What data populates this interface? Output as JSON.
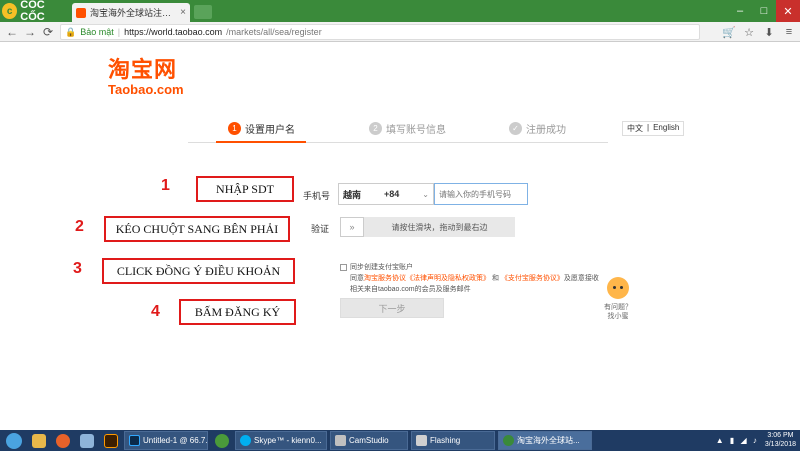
{
  "browser": {
    "brand": "CỐC CỐC",
    "tab_title": "淘宝海外全球站注册页面",
    "tab_close": "×",
    "secure_label": "Bảo mật",
    "url_host": "https://world.taobao.com",
    "url_path": "/markets/all/sea/register"
  },
  "page": {
    "logo_cn": "淘宝网",
    "logo_en": "Taobao.com",
    "steps": [
      {
        "num": "1",
        "label": "设置用户名"
      },
      {
        "num": "2",
        "label": "填写账号信息"
      },
      {
        "num": "✓",
        "label": "注册成功"
      }
    ],
    "lang": {
      "zh": "中文",
      "sep": "|",
      "en": "English"
    },
    "form": {
      "phone_label": "手机号",
      "country": "越南",
      "country_code": "+84",
      "phone_placeholder": "请输入你的手机号码",
      "verify_label": "验证",
      "slider_handle": "»",
      "slider_text": "请按住滑块，拖动到最右边",
      "agree_line1": "同步创建支付宝账户",
      "agree_prefix": "同意",
      "agree_link1": "淘宝服务协议",
      "agree_link2": "《法律声明及隐私权政策》",
      "agree_and": "和",
      "agree_link3": "《支付宝服务协议》",
      "agree_suffix": "及愿意接收",
      "agree_line3": "相关来自taobao.com的会员及服务邮件",
      "next_button": "下一步"
    },
    "helper": {
      "line1": "有问题？",
      "line2": "找小蜜"
    }
  },
  "annotations": [
    {
      "num": "1",
      "text": "NHẬP SDT"
    },
    {
      "num": "2",
      "text": "KÉO CHUỘT SANG BÊN PHẢI"
    },
    {
      "num": "3",
      "text": "CLICK ĐỒNG Ý ĐIỀU KHOẢN"
    },
    {
      "num": "4",
      "text": "BẤM ĐĂNG KÝ"
    }
  ],
  "taskbar": {
    "apps": [
      {
        "label": "Untitled-1 @ 66.7..."
      },
      {
        "label": "Skype™ - kienn0..."
      },
      {
        "label": "CamStudio"
      },
      {
        "label": "Flashing"
      },
      {
        "label": "淘宝海外全球站..."
      }
    ],
    "time": "3:06 PM",
    "date": "3/13/2018"
  },
  "colors": {
    "taobao_orange": "#ff5000",
    "annotation_red": "#e01a1a",
    "browser_green": "#3a8a3a",
    "taskbar_blue": "#1f3b63"
  }
}
